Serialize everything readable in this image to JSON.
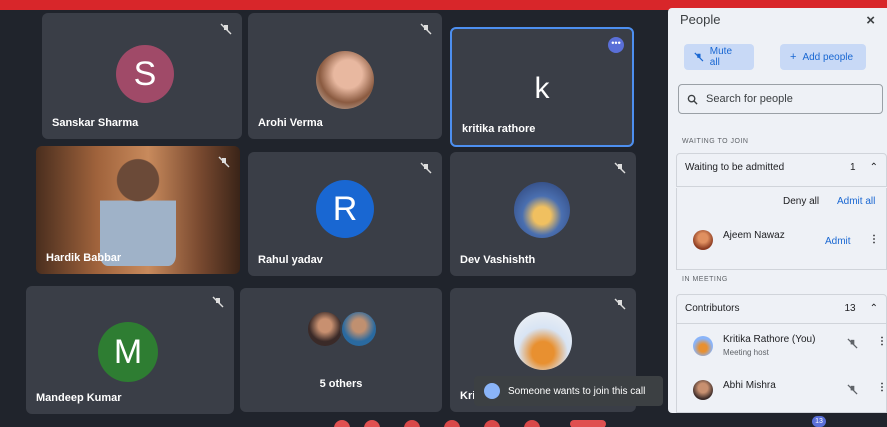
{
  "tiles": [
    {
      "name": "Sanskar Sharma",
      "initial": "S",
      "color": "#a04a68"
    },
    {
      "name": "Arohi Verma"
    },
    {
      "name": "kritika rathore",
      "initial": "k"
    },
    {
      "name": "Hardik Babbar"
    },
    {
      "name": "Rahul yadav",
      "initial": "R",
      "color": "#1967d2"
    },
    {
      "name": "Dev Vashishth"
    },
    {
      "name": "Mandeep Kumar",
      "initial": "M",
      "color": "#2e7d32"
    },
    {
      "name": "5 others"
    },
    {
      "name": "Kri"
    }
  ],
  "panel": {
    "title": "People",
    "close": "×",
    "mute_all": "Mute all",
    "add_people": "Add people",
    "search_placeholder": "Search for people",
    "waiting_header": "WAITING TO JOIN",
    "waiting_label": "Waiting to be admitted",
    "waiting_count": "1",
    "deny_all": "Deny all",
    "admit_all": "Admit all",
    "waiting_person": "Ajeem Nawaz",
    "admit": "Admit",
    "in_meeting_header": "IN MEETING",
    "contributors_label": "Contributors",
    "contributors_count": "13",
    "people": [
      {
        "name": "Kritika Rathore (You)",
        "role": "Meeting host"
      },
      {
        "name": "Abhi Mishra",
        "role": ""
      }
    ]
  },
  "toast": "Someone wants to join this call",
  "badge": "13",
  "colors": {
    "accent": "#1967d2",
    "tile": "#3a3e47",
    "panel": "#eef1f6",
    "topbar": "#d8262a"
  }
}
